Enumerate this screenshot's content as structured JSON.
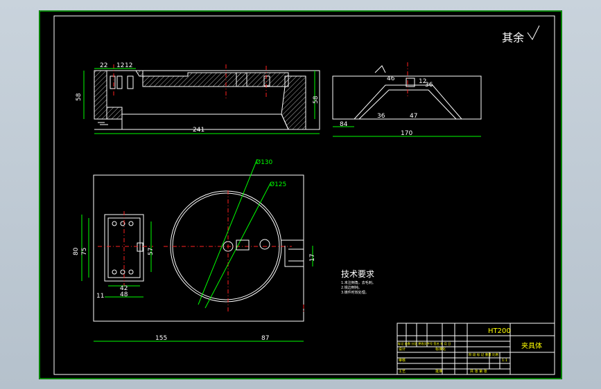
{
  "drawing": {
    "roughness_note": "其余",
    "side_view": {
      "dims": [
        "22",
        "12",
        "12",
        "241"
      ],
      "heights": [
        "58",
        "58"
      ]
    },
    "end_view": {
      "dims": [
        "46",
        "12",
        "36",
        "36",
        "47",
        "84",
        "170"
      ]
    },
    "plan_view": {
      "circle_large": "Ø130",
      "circle_small": "Ø125",
      "left_block": [
        "80",
        "75",
        "57",
        "42",
        "48",
        "11"
      ],
      "right_dim": "17",
      "bottom": [
        "155",
        "87"
      ]
    },
    "tech_req": {
      "title": "技术要求",
      "lines": [
        "1.未注倒角，去毛刺。",
        "2.锐边倒钝。",
        "3.铸件时效处理。"
      ]
    },
    "title_block": {
      "material": "HT200",
      "part_name": "夹具体",
      "row1": "标记 处数 分区 更改文件号 签名 年 月 日",
      "row2a": "设计",
      "row2b": "标准化",
      "row3a": "审核",
      "row4a": "工艺",
      "row4b": "批准",
      "stage_row": "阶 段 标 记 重量 比例",
      "scale": "1:1",
      "sheet_row": "共 张 第 张"
    }
  }
}
